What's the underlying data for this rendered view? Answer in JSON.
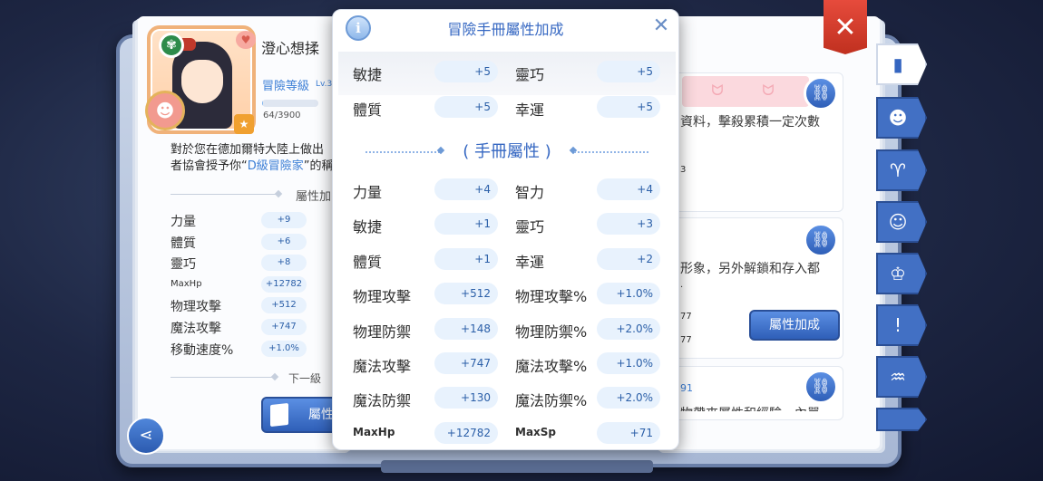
{
  "player": {
    "name": "澄心想揉",
    "adv_level_label": "冒險等級",
    "adv_level_value": "Lv.3",
    "exp_text": "64/3900",
    "exp_fraction": 0.02,
    "desc_line1_a": "對於您在德加爾特大陸上做出",
    "desc_line2_a": "者協會授予你“",
    "desc_line2_hl": "D級冒險家",
    "desc_line2_b": "”的稱"
  },
  "left_page": {
    "attr_divider_label": "屬性加",
    "stats": [
      {
        "name": "力量",
        "value": "+9"
      },
      {
        "name": "體質",
        "value": "+6"
      },
      {
        "name": "靈巧",
        "value": "+8"
      },
      {
        "name": "MaxHp",
        "value": "+12782"
      },
      {
        "name": "物理攻擊",
        "value": "+512"
      },
      {
        "name": "魔法攻擊",
        "value": "+747"
      },
      {
        "name": "移動速度%",
        "value": "+1.0%"
      }
    ],
    "next_level_label": "下一級",
    "attr_button_label": "屬性"
  },
  "right_page": {
    "text1": "資料，擊殺累積一定次數",
    "value1": "3",
    "text2": "形象，另外解鎖和存入都",
    "mark2": "·",
    "value2a": "77",
    "value2b": "77",
    "attr_button_label": "屬性加成",
    "value3": "91",
    "text3": "物帶來屬性和經驗，內單"
  },
  "modal": {
    "title": "冒險手冊屬性加成",
    "top_rows": [
      [
        {
          "name": "敏捷",
          "value": "+5"
        },
        {
          "name": "靈巧",
          "value": "+5"
        }
      ],
      [
        {
          "name": "體質",
          "value": "+5"
        },
        {
          "name": "幸運",
          "value": "+5"
        }
      ]
    ],
    "section_label": "手冊屬性",
    "rows": [
      [
        {
          "name": "力量",
          "value": "+4"
        },
        {
          "name": "智力",
          "value": "+4"
        }
      ],
      [
        {
          "name": "敏捷",
          "value": "+1"
        },
        {
          "name": "靈巧",
          "value": "+3"
        }
      ],
      [
        {
          "name": "體質",
          "value": "+1"
        },
        {
          "name": "幸運",
          "value": "+2"
        }
      ],
      [
        {
          "name": "物理攻擊",
          "value": "+512"
        },
        {
          "name": "物理攻擊%",
          "value": "+1.0%"
        }
      ],
      [
        {
          "name": "物理防禦",
          "value": "+148"
        },
        {
          "name": "物理防禦%",
          "value": "+2.0%"
        }
      ],
      [
        {
          "name": "魔法攻擊",
          "value": "+747"
        },
        {
          "name": "魔法攻擊%",
          "value": "+1.0%"
        }
      ],
      [
        {
          "name": "魔法防禦",
          "value": "+130"
        },
        {
          "name": "魔法防禦%",
          "value": "+2.0%"
        }
      ],
      [
        {
          "name": "MaxHp",
          "value": "+12782"
        },
        {
          "name": "MaxSp",
          "value": "+71"
        }
      ]
    ]
  },
  "icons": {
    "close": "close-icon",
    "info": "info-icon",
    "share": "share-icon",
    "link": "link-icon",
    "tabs": [
      "book-icon",
      "monster-face-icon",
      "horns-icon",
      "pet-face-icon",
      "chef-hat-icon",
      "quest-icon",
      "open-book-icon",
      "card-icon"
    ]
  },
  "colors": {
    "accent_blue": "#3567c2",
    "value_pill": "#e8f2fd",
    "close_red": "#d63b2b"
  }
}
